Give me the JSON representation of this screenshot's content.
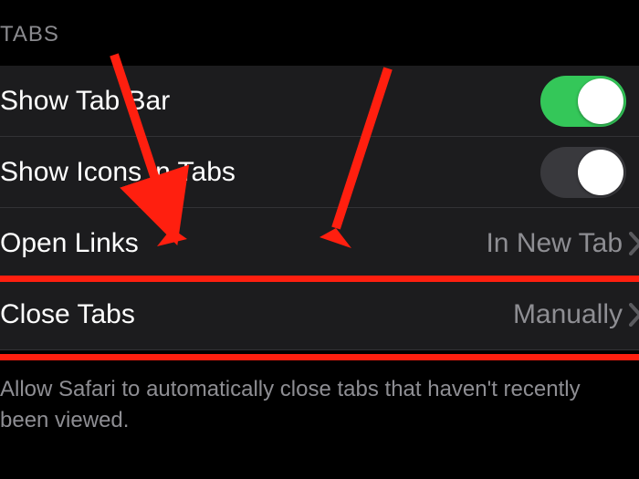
{
  "section_header": "TABS",
  "rows": {
    "showTabBar": {
      "label": "Show Tab Bar",
      "toggle": true,
      "on": true
    },
    "showIconsInTabs": {
      "label": "Show Icons in Tabs",
      "toggle": true,
      "on": false
    },
    "openLinks": {
      "label": "Open Links",
      "value": "In New Tab"
    },
    "closeTabs": {
      "label": "Close Tabs",
      "value": "Manually"
    }
  },
  "footer": "Allow Safari to automatically close tabs that haven't recently been viewed.",
  "colors": {
    "highlight": "#ff1f0f",
    "toggle_on": "#34c759",
    "toggle_off": "#39393d",
    "row_bg": "#1c1c1e",
    "secondary_text": "#8e8e93"
  }
}
